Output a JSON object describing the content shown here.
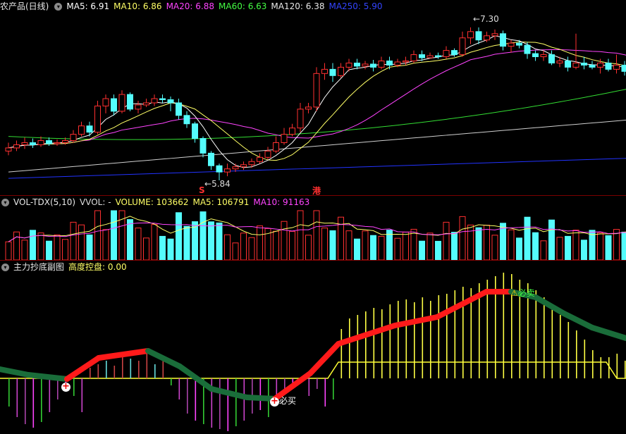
{
  "price_panel": {
    "title": "农产品(日线)",
    "indicators": [
      {
        "label": "MA5: 6.91",
        "color": "#ffffff"
      },
      {
        "label": "MA10: 6.86",
        "color": "#ffff66"
      },
      {
        "label": "MA20: 6.88",
        "color": "#ff44ff"
      },
      {
        "label": "MA60: 6.63",
        "color": "#44ff44"
      },
      {
        "label": "MA120: 6.38",
        "color": "#e8e8e8"
      },
      {
        "label": "MA250: 5.90",
        "color": "#2233ff"
      }
    ],
    "high_label": "7.30",
    "low_label": "5.84",
    "marker_s": "S",
    "marker_gang": "港",
    "candles": [
      [
        6.12,
        6.15,
        6.2,
        6.08
      ],
      [
        6.15,
        6.18,
        6.22,
        6.12
      ],
      [
        6.18,
        6.2,
        6.25,
        6.14
      ],
      [
        6.2,
        6.18,
        6.24,
        6.15
      ],
      [
        6.18,
        6.22,
        6.26,
        6.16
      ],
      [
        6.22,
        6.19,
        6.25,
        6.17
      ],
      [
        6.19,
        6.2,
        6.23,
        6.17
      ],
      [
        6.2,
        6.22,
        6.25,
        6.18
      ],
      [
        6.22,
        6.28,
        6.32,
        6.2
      ],
      [
        6.28,
        6.36,
        6.4,
        6.26
      ],
      [
        6.36,
        6.3,
        6.4,
        6.26
      ],
      [
        6.3,
        6.55,
        6.6,
        6.28
      ],
      [
        6.55,
        6.62,
        6.66,
        6.48
      ],
      [
        6.62,
        6.5,
        6.66,
        6.46
      ],
      [
        6.5,
        6.66,
        6.7,
        6.48
      ],
      [
        6.66,
        6.52,
        6.68,
        6.5
      ],
      [
        6.52,
        6.56,
        6.6,
        6.48
      ],
      [
        6.56,
        6.58,
        6.62,
        6.54
      ],
      [
        6.58,
        6.62,
        6.66,
        6.55
      ],
      [
        6.62,
        6.61,
        6.66,
        6.58
      ],
      [
        6.61,
        6.58,
        6.64,
        6.5
      ],
      [
        6.58,
        6.46,
        6.62,
        6.42
      ],
      [
        6.46,
        6.38,
        6.5,
        6.34
      ],
      [
        6.38,
        6.24,
        6.4,
        6.2
      ],
      [
        6.24,
        6.1,
        6.26,
        6.06
      ],
      [
        6.1,
        5.98,
        6.12,
        5.94
      ],
      [
        5.98,
        5.92,
        6.0,
        5.84
      ],
      [
        5.92,
        5.95,
        6.0,
        5.88
      ],
      [
        5.95,
        5.97,
        6.0,
        5.92
      ],
      [
        5.97,
        5.99,
        6.02,
        5.94
      ],
      [
        5.99,
        6.02,
        6.05,
        5.96
      ],
      [
        6.02,
        6.06,
        6.1,
        6.0
      ],
      [
        6.06,
        6.12,
        6.16,
        6.04
      ],
      [
        6.12,
        6.2,
        6.26,
        6.1
      ],
      [
        6.2,
        6.28,
        6.34,
        6.18
      ],
      [
        6.28,
        6.34,
        6.38,
        6.26
      ],
      [
        6.34,
        6.52,
        6.58,
        6.3
      ],
      [
        6.52,
        6.54,
        6.58,
        6.48
      ],
      [
        6.54,
        6.86,
        6.92,
        6.5
      ],
      [
        6.86,
        6.9,
        6.96,
        6.8
      ],
      [
        6.9,
        6.84,
        6.96,
        6.78
      ],
      [
        6.84,
        6.92,
        6.96,
        6.82
      ],
      [
        6.92,
        6.96,
        7.0,
        6.88
      ],
      [
        6.96,
        6.93,
        7.0,
        6.9
      ],
      [
        6.93,
        6.95,
        6.98,
        6.9
      ],
      [
        6.95,
        6.92,
        6.99,
        6.88
      ],
      [
        6.92,
        6.98,
        7.02,
        6.9
      ],
      [
        6.98,
        6.94,
        7.02,
        6.9
      ],
      [
        6.94,
        6.97,
        7.0,
        6.92
      ],
      [
        6.97,
        6.98,
        7.02,
        6.94
      ],
      [
        6.98,
        7.04,
        7.08,
        6.96
      ],
      [
        7.04,
        7.01,
        7.08,
        6.98
      ],
      [
        7.01,
        7.03,
        7.06,
        7.0
      ],
      [
        7.03,
        7.02,
        7.06,
        7.0
      ],
      [
        7.02,
        7.08,
        7.12,
        7.0
      ],
      [
        7.08,
        7.04,
        7.1,
        7.02
      ],
      [
        7.04,
        7.2,
        7.26,
        7.02
      ],
      [
        7.2,
        7.26,
        7.3,
        7.14
      ],
      [
        7.26,
        7.18,
        7.3,
        7.14
      ],
      [
        7.18,
        7.22,
        7.26,
        7.16
      ],
      [
        7.22,
        7.24,
        7.28,
        7.18
      ],
      [
        7.24,
        7.12,
        7.27,
        7.08
      ],
      [
        7.12,
        7.15,
        7.18,
        7.06
      ],
      [
        7.15,
        7.13,
        7.18,
        7.1
      ],
      [
        7.13,
        7.05,
        7.16,
        7.0
      ],
      [
        7.05,
        7.02,
        7.08,
        6.98
      ],
      [
        7.02,
        7.04,
        7.08,
        6.98
      ],
      [
        7.04,
        6.96,
        7.08,
        6.94
      ],
      [
        6.96,
        6.98,
        7.02,
        6.92
      ],
      [
        6.98,
        6.92,
        7.02,
        6.88
      ],
      [
        6.92,
        6.96,
        7.24,
        6.9
      ],
      [
        6.96,
        6.94,
        7.02,
        6.9
      ],
      [
        6.94,
        6.92,
        6.98,
        6.9
      ],
      [
        6.92,
        6.96,
        7.0,
        6.86
      ],
      [
        6.96,
        6.9,
        7.0,
        6.88
      ],
      [
        6.9,
        6.94,
        7.04,
        6.86
      ],
      [
        6.94,
        6.88,
        6.98,
        6.84
      ],
      [
        6.88,
        6.91,
        6.94,
        6.86
      ]
    ]
  },
  "volume_panel": {
    "title": "VOL-TDX(5,10)",
    "labels": [
      {
        "label": "VVOL: -",
        "color": "#dddddd"
      },
      {
        "label": "VOLUME: 103662",
        "color": "#ffff66"
      },
      {
        "label": "MA5: 106791",
        "color": "#ffff66"
      },
      {
        "label": "MA10: 91163",
        "color": "#ff44ff"
      }
    ]
  },
  "indicator_panel": {
    "title": "主力抄底副图",
    "subtitle": "高度控盘: 0.00",
    "buy_label": "必买",
    "buy_label_2": "必买",
    "sell_label": "必卖"
  },
  "colors": {
    "up": "#ff3030",
    "down": "#54fcfc",
    "bg": "#000000",
    "separator": "#7a0000"
  }
}
